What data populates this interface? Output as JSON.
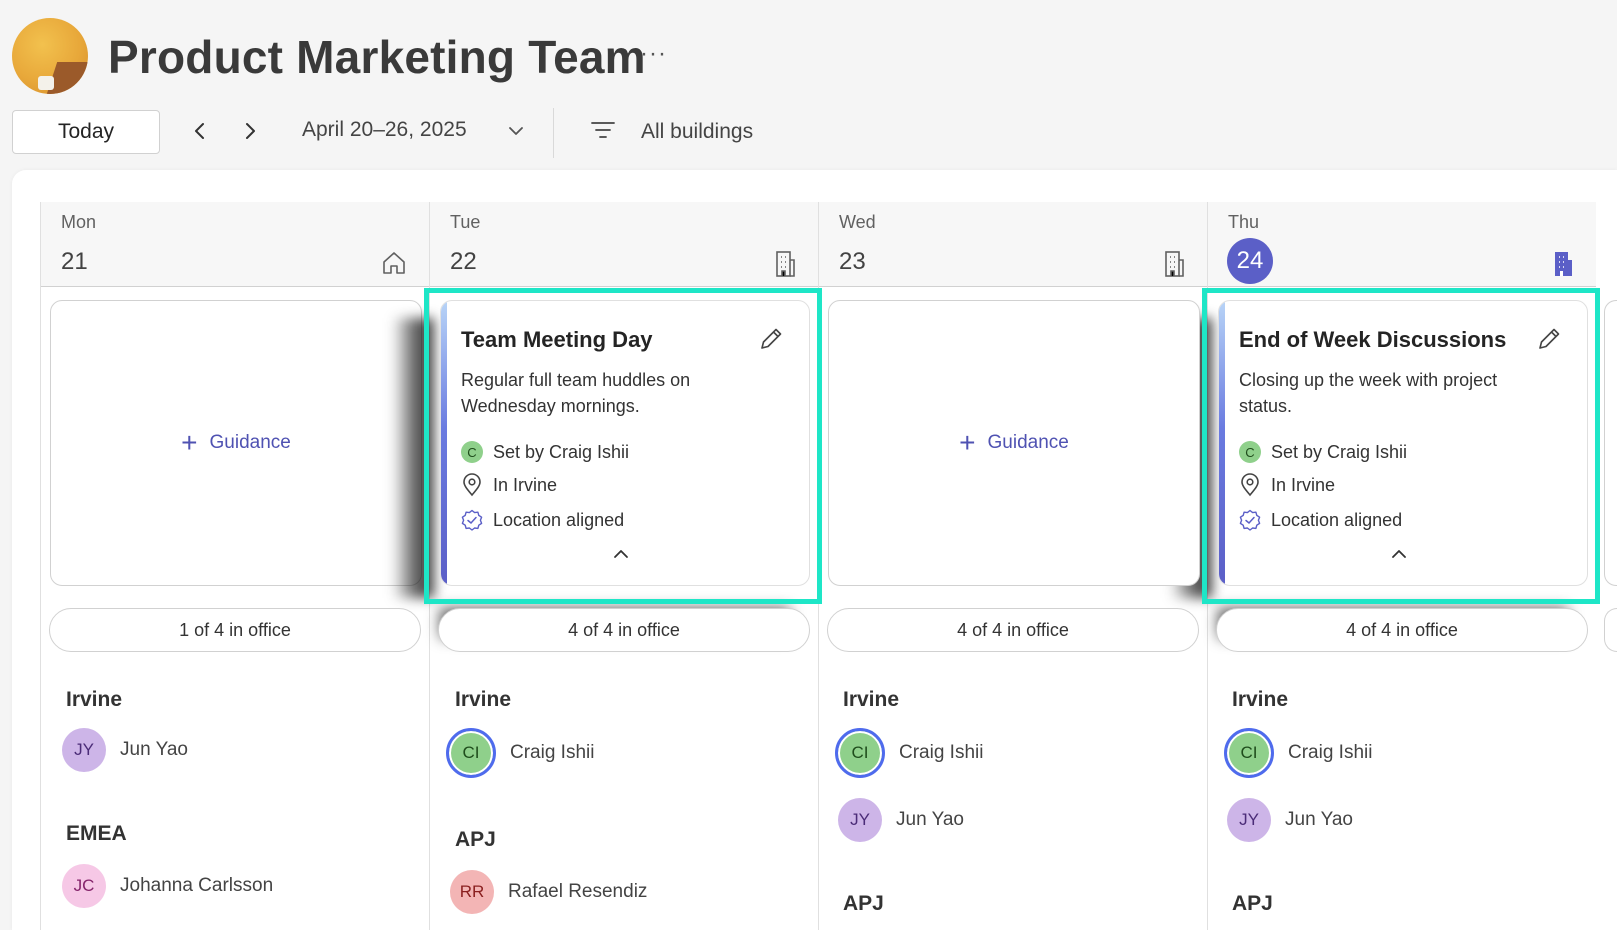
{
  "header": {
    "title": "Product Marketing Team",
    "more_label": "···"
  },
  "toolbar": {
    "today_label": "Today",
    "date_range": "April 20–26, 2025",
    "filter_label": "All buildings"
  },
  "days": [
    {
      "name": "Mon",
      "number": "21",
      "location_icon": "home-icon",
      "is_today": false,
      "office_count": "1 of 4 in office",
      "guidance_label": "Guidance",
      "groups": [
        {
          "label": "Irvine",
          "people": [
            {
              "initials": "JY",
              "name": "Jun Yao"
            }
          ]
        },
        {
          "label": "EMEA",
          "people": [
            {
              "initials": "JC",
              "name": "Johanna Carlsson"
            }
          ]
        }
      ]
    },
    {
      "name": "Tue",
      "number": "22",
      "location_icon": "building-icon",
      "is_today": false,
      "office_count": "4 of 4 in office",
      "event": {
        "title": "Team Meeting Day",
        "description": "Regular full team huddles on Wednesday mornings.",
        "set_by_initial": "C",
        "set_by": "Set by Craig Ishii",
        "location": "In Irvine",
        "status": "Location aligned"
      },
      "groups": [
        {
          "label": "Irvine",
          "people": [
            {
              "initials": "CI",
              "name": "Craig Ishii"
            }
          ]
        },
        {
          "label": "APJ",
          "people": [
            {
              "initials": "RR",
              "name": "Rafael Resendiz"
            }
          ]
        }
      ]
    },
    {
      "name": "Wed",
      "number": "23",
      "location_icon": "building-icon",
      "is_today": false,
      "office_count": "4 of 4 in office",
      "guidance_label": "Guidance",
      "groups": [
        {
          "label": "Irvine",
          "people": [
            {
              "initials": "CI",
              "name": "Craig Ishii"
            },
            {
              "initials": "JY",
              "name": "Jun Yao"
            }
          ]
        },
        {
          "label": "APJ",
          "people": []
        }
      ]
    },
    {
      "name": "Thu",
      "number": "24",
      "location_icon": "building-icon",
      "is_today": true,
      "office_count": "4 of 4 in office",
      "event": {
        "title": "End of Week Discussions",
        "description": "Closing up the week with project status.",
        "set_by_initial": "C",
        "set_by": "Set by Craig Ishii",
        "location": "In Irvine",
        "status": "Location aligned"
      },
      "groups": [
        {
          "label": "Irvine",
          "people": [
            {
              "initials": "CI",
              "name": "Craig Ishii"
            },
            {
              "initials": "JY",
              "name": "Jun Yao"
            }
          ]
        },
        {
          "label": "APJ",
          "people": []
        }
      ]
    }
  ],
  "colors": {
    "accent": "#5b5fc7",
    "highlight": "#1ee6c7",
    "link": "#4f52b2"
  }
}
